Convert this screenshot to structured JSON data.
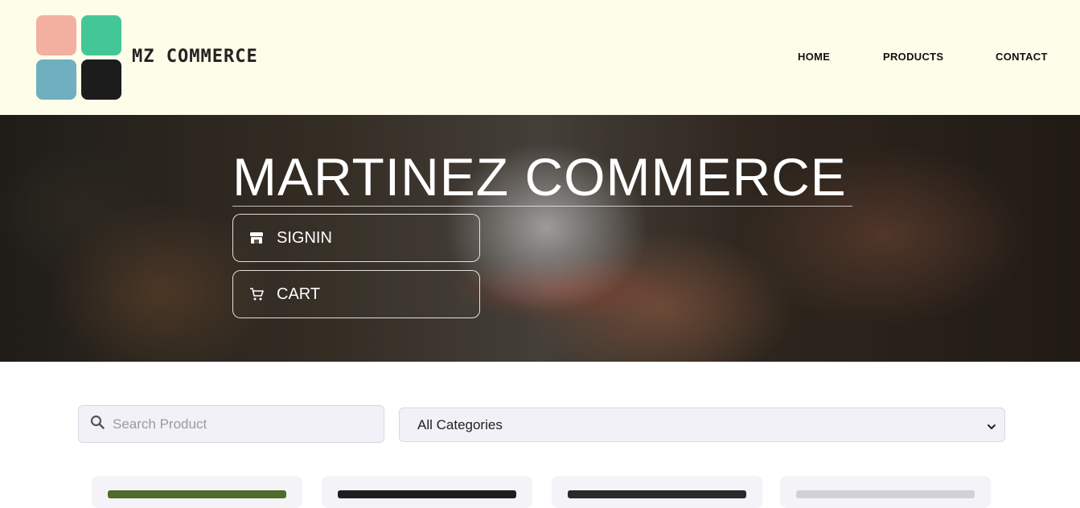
{
  "header": {
    "brand": "MZ COMMERCE",
    "nav": [
      {
        "label": "HOME"
      },
      {
        "label": "PRODUCTS"
      },
      {
        "label": "CONTACT"
      }
    ],
    "logo_colors": [
      "#f3b0a0",
      "#44c797",
      "#70afc0",
      "#1c1c1c"
    ]
  },
  "hero": {
    "title": "MARTINEZ COMMERCE",
    "buttons": [
      {
        "label": "SIGNIN",
        "icon": "store-icon"
      },
      {
        "label": "CART",
        "icon": "cart-icon"
      }
    ]
  },
  "filters": {
    "search_placeholder": "Search Product",
    "search_value": "",
    "category_selected": "All Categories"
  },
  "products": {
    "card_image_colors": [
      "#4f6a2a",
      "#1e1e1e",
      "#2a2a2a",
      "#cfd2d8"
    ]
  }
}
